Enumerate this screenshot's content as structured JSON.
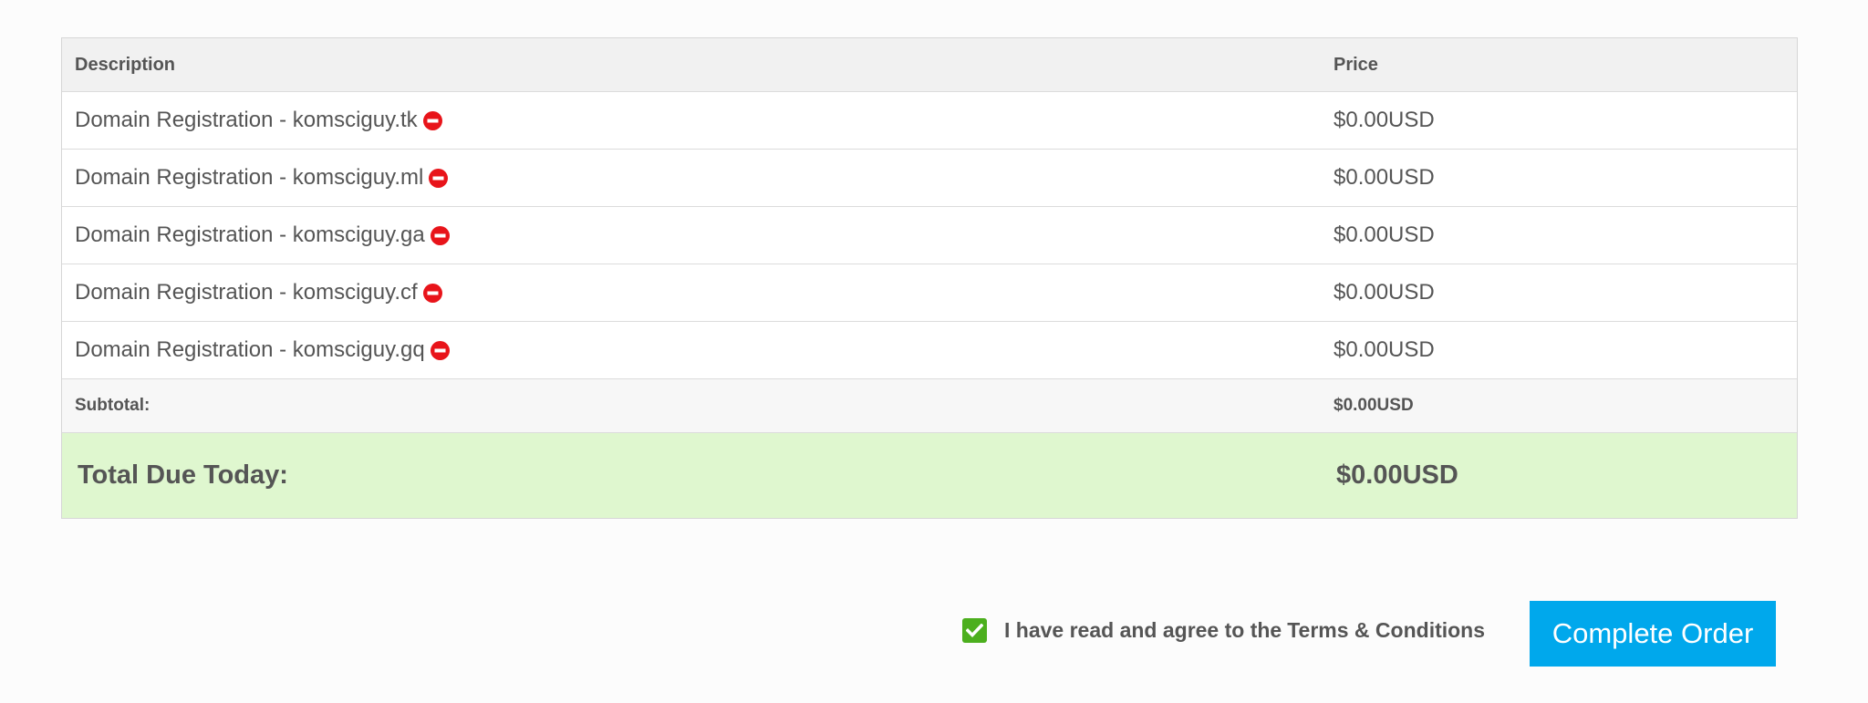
{
  "table": {
    "headers": {
      "description": "Description",
      "price": "Price"
    },
    "items": [
      {
        "description": "Domain Registration - komsciguy.tk",
        "price": "$0.00USD"
      },
      {
        "description": "Domain Registration - komsciguy.ml",
        "price": "$0.00USD"
      },
      {
        "description": "Domain Registration - komsciguy.ga",
        "price": "$0.00USD"
      },
      {
        "description": "Domain Registration - komsciguy.cf",
        "price": "$0.00USD"
      },
      {
        "description": "Domain Registration - komsciguy.gq",
        "price": "$0.00USD"
      }
    ],
    "subtotal_label": "Subtotal:",
    "subtotal_value": "$0.00USD",
    "total_label": "Total Due Today:",
    "total_value": "$0.00USD"
  },
  "icons": {
    "remove": "remove-icon",
    "checkbox": "checkmark-icon"
  },
  "agreement": {
    "text": "I have read and agree to the",
    "link": "Terms & Conditions",
    "checked": true
  },
  "actions": {
    "complete_order": "Complete Order"
  },
  "colors": {
    "total_background": "#dff7cf",
    "button": "#00a8ec",
    "remove_icon": "#e8141a",
    "checkbox": "#4caf1e"
  }
}
